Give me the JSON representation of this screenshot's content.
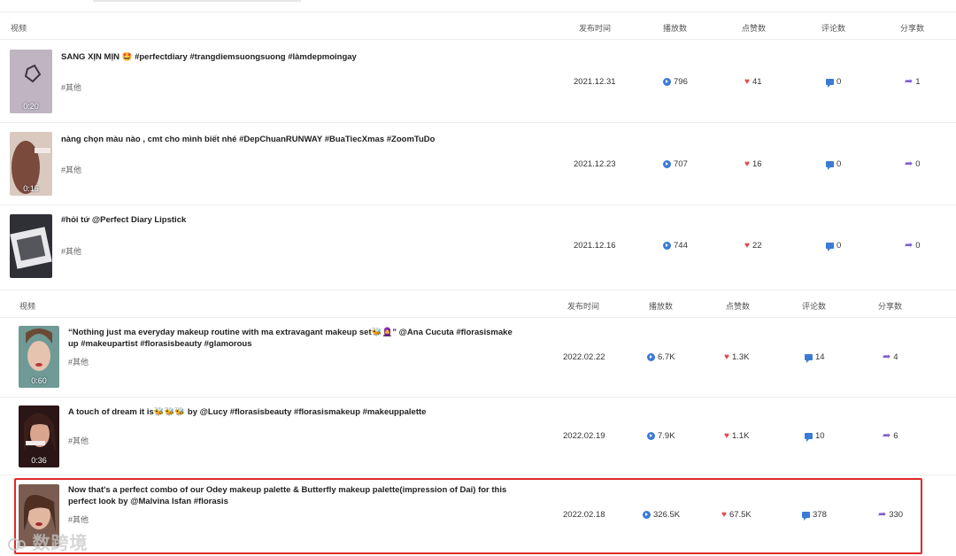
{
  "columns": {
    "video": "视频",
    "publish_time": "发布时间",
    "plays": "播放数",
    "likes": "点赞数",
    "comments": "评论数",
    "shares": "分享数"
  },
  "table1": [
    {
      "title": "SANG XỊN MỊN 🤩 #perfectdiary #trangdiemsuongsuong #làmdepmoingay",
      "tag": "#其他",
      "duration": "0:20",
      "date": "2021.12.31",
      "plays": "796",
      "likes": "41",
      "comments": "0",
      "shares": "1",
      "thumb_color": "#b8aebb"
    },
    {
      "title": "nàng chọn màu nào , cmt cho mình biết nhé #DepChuanRUNWAY #BuaTiecXmas #ZoomTuDo",
      "tag": "#其他",
      "duration": "0:15",
      "date": "2021.12.23",
      "plays": "707",
      "likes": "16",
      "comments": "0",
      "shares": "0",
      "thumb_color": "#7a4a3c"
    },
    {
      "title": "#hỏi tứ @Perfect Diary Lipstick",
      "tag": "#其他",
      "duration": "",
      "date": "2021.12.16",
      "plays": "744",
      "likes": "22",
      "comments": "0",
      "shares": "0",
      "thumb_color": "#4a4a52"
    }
  ],
  "table2": [
    {
      "title": "“Nothing just ma everyday makeup routine with ma extravagant makeup set🐝🧕” @Ana Cucuta #florasismake up #makeupartist #florasisbeauty #glamorous",
      "tag": "#其他",
      "duration": "0:60",
      "date": "2022.02.22",
      "plays": "6.7K",
      "likes": "1.3K",
      "comments": "14",
      "shares": "4",
      "thumb_color": "#5f8a88"
    },
    {
      "title": "A touch of dream it is🐝🐝🐝 by @Lucy #florasisbeauty #florasismakeup #makeuppalette",
      "tag": "#其他",
      "duration": "0:36",
      "date": "2022.02.19",
      "plays": "7.9K",
      "likes": "1.1K",
      "comments": "10",
      "shares": "6",
      "thumb_color": "#3a2220"
    },
    {
      "title": "Now that's a perfect combo of our Odey makeup palette & Butterfly makeup palette(impression of Dai) for this perfect look by @Malvina Isfan #florasis",
      "tag": "#其他",
      "duration": "",
      "date": "2022.02.18",
      "plays": "326.5K",
      "likes": "67.5K",
      "comments": "378",
      "shares": "330",
      "thumb_color": "#8a6a5a"
    }
  ],
  "watermark": "数跨境"
}
